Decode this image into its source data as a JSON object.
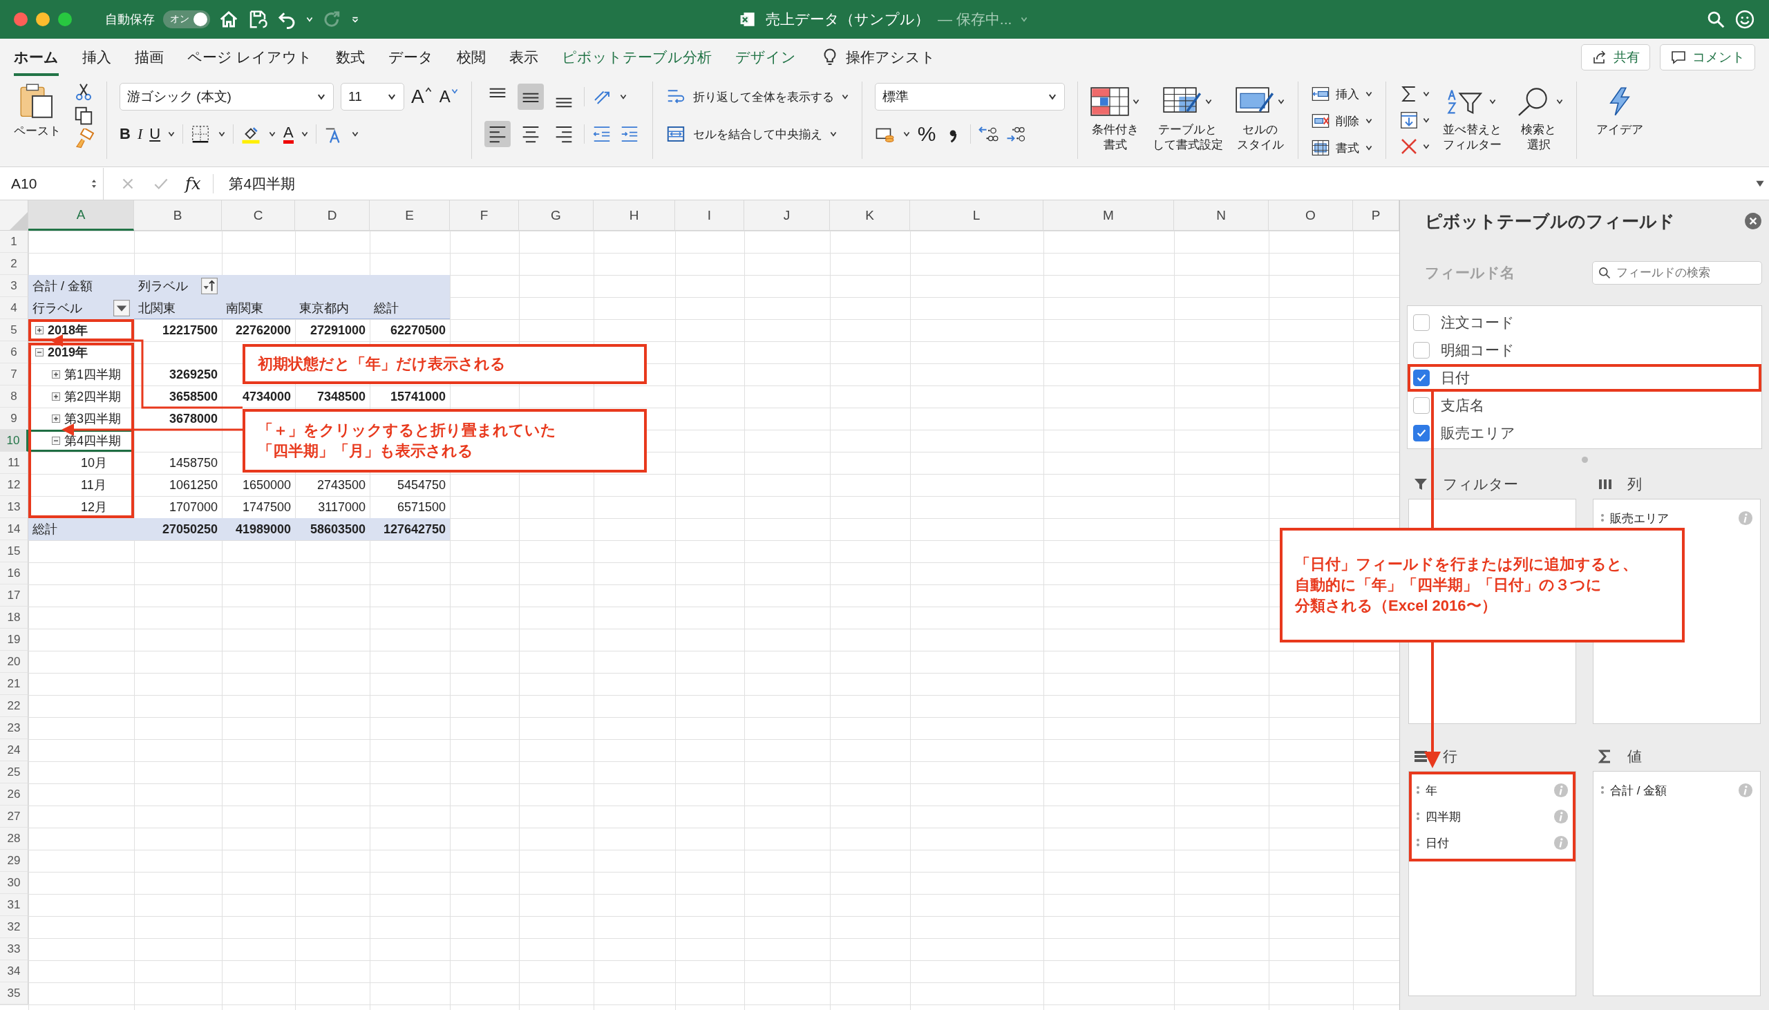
{
  "window": {
    "title": "売上データ（サンプル）",
    "save_status": "— 保存中...",
    "autosave": {
      "label": "自動保存",
      "toggle": "オン",
      "on": true
    }
  },
  "tabs": [
    {
      "label": "ホーム",
      "selected": true,
      "kind": "standard"
    },
    {
      "label": "挿入",
      "selected": false,
      "kind": "standard"
    },
    {
      "label": "描画",
      "selected": false,
      "kind": "standard"
    },
    {
      "label": "ページ レイアウト",
      "selected": false,
      "kind": "standard"
    },
    {
      "label": "数式",
      "selected": false,
      "kind": "standard"
    },
    {
      "label": "データ",
      "selected": false,
      "kind": "standard"
    },
    {
      "label": "校閲",
      "selected": false,
      "kind": "standard"
    },
    {
      "label": "表示",
      "selected": false,
      "kind": "standard"
    },
    {
      "label": "ピボットテーブル分析",
      "selected": false,
      "kind": "contextual"
    },
    {
      "label": "デザイン",
      "selected": false,
      "kind": "contextual"
    }
  ],
  "tell_me": "操作アシスト",
  "share_button": "共有",
  "comment_button": "コメント",
  "ribbon": {
    "paste": "ペースト",
    "font_name": "游ゴシック (本文)",
    "font_size": "11",
    "grow_font": "A",
    "shrink_font": "A",
    "bold": "B",
    "italic": "I",
    "underline": "U",
    "font_color": "A",
    "vertical_align": [
      {
        "selected": false
      },
      {
        "selected": true
      },
      {
        "selected": false
      }
    ],
    "horizontal_align": [
      {
        "selected": true
      },
      {
        "selected": false
      },
      {
        "selected": false
      }
    ],
    "wrap_text": "折り返して全体を表示する",
    "merge_center": "セルを結合して中央揃え",
    "number_format": "標準",
    "percent": "%",
    "style_buttons": [
      {
        "lines": [
          "条件付き",
          "書式"
        ],
        "kind": "conditional"
      },
      {
        "lines": [
          "テーブルと",
          "して書式設定"
        ],
        "kind": "table"
      },
      {
        "lines": [
          "セルの",
          "スタイル"
        ],
        "kind": "cellstyle"
      }
    ],
    "cell_buttons": [
      {
        "label": "挿入",
        "kind": "insert"
      },
      {
        "label": "削除",
        "kind": "delete"
      },
      {
        "label": "書式",
        "kind": "format"
      }
    ],
    "sort_filter": [
      "並べ替えと",
      "フィルター"
    ],
    "find_select": [
      "検索と",
      "選択"
    ],
    "ideas": "アイデア"
  },
  "formula_bar": {
    "name_box": "A10",
    "function_label": "fx",
    "value": "第4四半期"
  },
  "sheet": {
    "columns": [
      {
        "label": "A",
        "selected": true
      },
      {
        "label": "B",
        "selected": false
      },
      {
        "label": "C",
        "selected": false
      },
      {
        "label": "D",
        "selected": false
      },
      {
        "label": "E",
        "selected": false
      },
      {
        "label": "F",
        "selected": false
      },
      {
        "label": "G",
        "selected": false
      },
      {
        "label": "H",
        "selected": false
      },
      {
        "label": "I",
        "selected": false
      },
      {
        "label": "J",
        "selected": false
      },
      {
        "label": "K",
        "selected": false
      },
      {
        "label": "L",
        "selected": false
      },
      {
        "label": "M",
        "selected": false
      },
      {
        "label": "N",
        "selected": false
      },
      {
        "label": "O",
        "selected": false
      },
      {
        "label": "P",
        "selected": false
      }
    ],
    "row_numbers": [
      "1",
      "2",
      "3",
      "4",
      "5",
      "6",
      "7",
      "8",
      "9",
      "10",
      "11",
      "12",
      "13",
      "14",
      "15",
      "16",
      "17",
      "18",
      "19",
      "20",
      "21",
      "22",
      "23",
      "24",
      "25",
      "26",
      "27",
      "28",
      "29",
      "30",
      "31",
      "32",
      "33",
      "34",
      "35"
    ],
    "pivot": {
      "value_label": "合計 / 金額",
      "column_label": "列ラベル",
      "row_label": "行ラベル",
      "column_headers": [
        "北関東",
        "南関東",
        "東京都内",
        "総計"
      ],
      "rows": [
        {
          "label": "2018年",
          "expanded": false,
          "selected": false,
          "values": [
            "12217500",
            "22762000",
            "27291000",
            "62270500"
          ]
        },
        {
          "label": "2019年",
          "expanded": true,
          "selected": false,
          "children": [
            {
              "label": "第1四半期",
              "expanded": false,
              "selected": false,
              "values": [
                "3269250"
              ]
            },
            {
              "label": "第2四半期",
              "expanded": false,
              "selected": false,
              "values": [
                "3658500",
                "4734000",
                "7348500",
                "15741000"
              ]
            },
            {
              "label": "第3四半期",
              "expanded": false,
              "selected": false,
              "values": [
                "3678000"
              ]
            },
            {
              "label": "第4四半期",
              "expanded": true,
              "selected": true,
              "children": [
                {
                  "label": "10月",
                  "selected": false,
                  "values": [
                    "1458750"
                  ]
                },
                {
                  "label": "11月",
                  "selected": false,
                  "values": [
                    "1061250",
                    "1650000",
                    "2743500",
                    "5454750"
                  ]
                },
                {
                  "label": "12月",
                  "selected": false,
                  "values": [
                    "1707000",
                    "1747500",
                    "3117000",
                    "6571500"
                  ]
                }
              ]
            }
          ]
        }
      ],
      "grand_total": {
        "label": "総計",
        "values": [
          "27050250",
          "41989000",
          "58603500",
          "127642750"
        ]
      }
    }
  },
  "annotations": [
    {
      "lines": [
        "初期状態だと「年」だけ表示される"
      ]
    },
    {
      "lines": [
        "「＋」をクリックすると折り畳まれていた",
        "「四半期」「月」も表示される"
      ]
    },
    {
      "lines": [
        "「日付」フィールドを行または列に追加すると、",
        "自動的に「年」「四半期」「日付」の３つに",
        "分類される（Excel 2016〜）"
      ]
    }
  ],
  "pivot_pane": {
    "title": "ピボットテーブルのフィールド",
    "field_header": "フィールド名",
    "search_placeholder": "フィールドの検索",
    "fields": [
      {
        "label": "注文コード",
        "checked": false,
        "highlighted": false
      },
      {
        "label": "明細コード",
        "checked": false,
        "highlighted": false
      },
      {
        "label": "日付",
        "checked": true,
        "highlighted": true
      },
      {
        "label": "支店名",
        "checked": false,
        "highlighted": false
      },
      {
        "label": "販売エリア",
        "checked": true,
        "highlighted": false
      }
    ],
    "areas": [
      {
        "kind": "filter",
        "label": "フィルター",
        "highlighted": false
      },
      {
        "kind": "columns",
        "label": "列",
        "highlighted": false,
        "items": [
          {
            "label": "販売エリア"
          }
        ]
      },
      {
        "kind": "rows",
        "label": "行",
        "highlighted": true,
        "items": [
          {
            "label": "年"
          },
          {
            "label": "四半期"
          },
          {
            "label": "日付"
          }
        ]
      },
      {
        "kind": "values",
        "label": "値",
        "highlighted": false,
        "items": [
          {
            "label": "合計 / 金額"
          }
        ]
      }
    ]
  }
}
